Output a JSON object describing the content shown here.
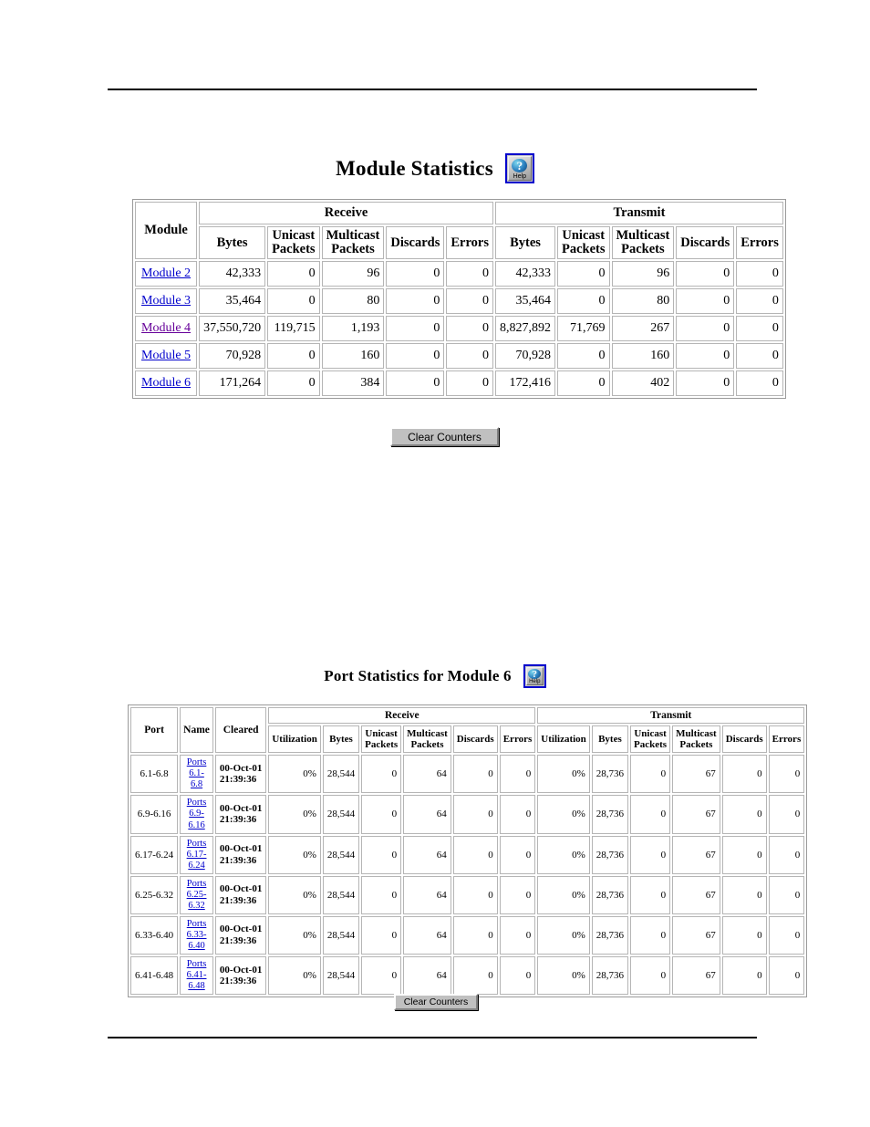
{
  "page": {
    "background_color": "#ffffff",
    "link_color": "#0000cc",
    "visited_link_color": "#660099"
  },
  "module_section": {
    "title": "Module Statistics",
    "help_icon_label": "Help",
    "help_icon_glyph": "?",
    "clear_button_label": "Clear Counters",
    "table": {
      "group_headers": [
        "Receive",
        "Transmit"
      ],
      "row_header": "Module",
      "sub_headers": [
        "Bytes",
        "Unicast Packets",
        "Multicast Packets",
        "Discards",
        "Errors"
      ],
      "sub_headers_split": [
        {
          "line1": "Bytes",
          "line2": ""
        },
        {
          "line1": "Unicast",
          "line2": "Packets"
        },
        {
          "line1": "Multicast",
          "line2": "Packets"
        },
        {
          "line1": "Discards",
          "line2": ""
        },
        {
          "line1": "Errors",
          "line2": ""
        }
      ],
      "rows": [
        {
          "module": "Module 2",
          "visited": false,
          "rx": {
            "bytes": "42,333",
            "unicast": "0",
            "multicast": "96",
            "discards": "0",
            "errors": "0"
          },
          "tx": {
            "bytes": "42,333",
            "unicast": "0",
            "multicast": "96",
            "discards": "0",
            "errors": "0"
          }
        },
        {
          "module": "Module 3",
          "visited": false,
          "rx": {
            "bytes": "35,464",
            "unicast": "0",
            "multicast": "80",
            "discards": "0",
            "errors": "0"
          },
          "tx": {
            "bytes": "35,464",
            "unicast": "0",
            "multicast": "80",
            "discards": "0",
            "errors": "0"
          }
        },
        {
          "module": "Module 4",
          "visited": true,
          "rx": {
            "bytes": "37,550,720",
            "unicast": "119,715",
            "multicast": "1,193",
            "discards": "0",
            "errors": "0"
          },
          "tx": {
            "bytes": "8,827,892",
            "unicast": "71,769",
            "multicast": "267",
            "discards": "0",
            "errors": "0"
          }
        },
        {
          "module": "Module 5",
          "visited": false,
          "rx": {
            "bytes": "70,928",
            "unicast": "0",
            "multicast": "160",
            "discards": "0",
            "errors": "0"
          },
          "tx": {
            "bytes": "70,928",
            "unicast": "0",
            "multicast": "160",
            "discards": "0",
            "errors": "0"
          }
        },
        {
          "module": "Module 6",
          "visited": false,
          "rx": {
            "bytes": "171,264",
            "unicast": "0",
            "multicast": "384",
            "discards": "0",
            "errors": "0"
          },
          "tx": {
            "bytes": "172,416",
            "unicast": "0",
            "multicast": "402",
            "discards": "0",
            "errors": "0"
          }
        }
      ]
    }
  },
  "port_section": {
    "title": "Port Statistics for Module 6",
    "help_icon_label": "Help",
    "help_icon_glyph": "?",
    "clear_button_label": "Clear Counters",
    "table": {
      "group_headers": [
        "Receive",
        "Transmit"
      ],
      "row_headers": [
        "Port",
        "Name",
        "Cleared"
      ],
      "sub_headers": [
        "Utilization",
        "Bytes",
        "Unicast Packets",
        "Multicast Packets",
        "Discards",
        "Errors"
      ],
      "sub_headers_split": [
        {
          "line1": "Utilization",
          "line2": ""
        },
        {
          "line1": "Bytes",
          "line2": ""
        },
        {
          "line1": "Unicast",
          "line2": "Packets"
        },
        {
          "line1": "Multicast",
          "line2": "Packets"
        },
        {
          "line1": "Discards",
          "line2": ""
        },
        {
          "line1": "Errors",
          "line2": ""
        }
      ],
      "rows": [
        {
          "port": "6.1-6.8",
          "name_line1": "Ports",
          "name_line2": "6.1-6.8",
          "cleared_line1": "00-Oct-01",
          "cleared_line2": "21:39:36",
          "rx": {
            "utilization": "0%",
            "bytes": "28,544",
            "unicast": "0",
            "multicast": "64",
            "discards": "0",
            "errors": "0"
          },
          "tx": {
            "utilization": "0%",
            "bytes": "28,736",
            "unicast": "0",
            "multicast": "67",
            "discards": "0",
            "errors": "0"
          }
        },
        {
          "port": "6.9-6.16",
          "name_line1": "Ports",
          "name_line2": "6.9-6.16",
          "cleared_line1": "00-Oct-01",
          "cleared_line2": "21:39:36",
          "rx": {
            "utilization": "0%",
            "bytes": "28,544",
            "unicast": "0",
            "multicast": "64",
            "discards": "0",
            "errors": "0"
          },
          "tx": {
            "utilization": "0%",
            "bytes": "28,736",
            "unicast": "0",
            "multicast": "67",
            "discards": "0",
            "errors": "0"
          }
        },
        {
          "port": "6.17-6.24",
          "name_line1": "Ports",
          "name_line2": "6.17-6.24",
          "cleared_line1": "00-Oct-01",
          "cleared_line2": "21:39:36",
          "rx": {
            "utilization": "0%",
            "bytes": "28,544",
            "unicast": "0",
            "multicast": "64",
            "discards": "0",
            "errors": "0"
          },
          "tx": {
            "utilization": "0%",
            "bytes": "28,736",
            "unicast": "0",
            "multicast": "67",
            "discards": "0",
            "errors": "0"
          }
        },
        {
          "port": "6.25-6.32",
          "name_line1": "Ports",
          "name_line2": "6.25-6.32",
          "cleared_line1": "00-Oct-01",
          "cleared_line2": "21:39:36",
          "rx": {
            "utilization": "0%",
            "bytes": "28,544",
            "unicast": "0",
            "multicast": "64",
            "discards": "0",
            "errors": "0"
          },
          "tx": {
            "utilization": "0%",
            "bytes": "28,736",
            "unicast": "0",
            "multicast": "67",
            "discards": "0",
            "errors": "0"
          }
        },
        {
          "port": "6.33-6.40",
          "name_line1": "Ports",
          "name_line2": "6.33-6.40",
          "cleared_line1": "00-Oct-01",
          "cleared_line2": "21:39:36",
          "rx": {
            "utilization": "0%",
            "bytes": "28,544",
            "unicast": "0",
            "multicast": "64",
            "discards": "0",
            "errors": "0"
          },
          "tx": {
            "utilization": "0%",
            "bytes": "28,736",
            "unicast": "0",
            "multicast": "67",
            "discards": "0",
            "errors": "0"
          }
        },
        {
          "port": "6.41-6.48",
          "name_line1": "Ports",
          "name_line2": "6.41-6.48",
          "cleared_line1": "00-Oct-01",
          "cleared_line2": "21:39:36",
          "rx": {
            "utilization": "0%",
            "bytes": "28,544",
            "unicast": "0",
            "multicast": "64",
            "discards": "0",
            "errors": "0"
          },
          "tx": {
            "utilization": "0%",
            "bytes": "28,736",
            "unicast": "0",
            "multicast": "67",
            "discards": "0",
            "errors": "0"
          }
        }
      ]
    }
  }
}
